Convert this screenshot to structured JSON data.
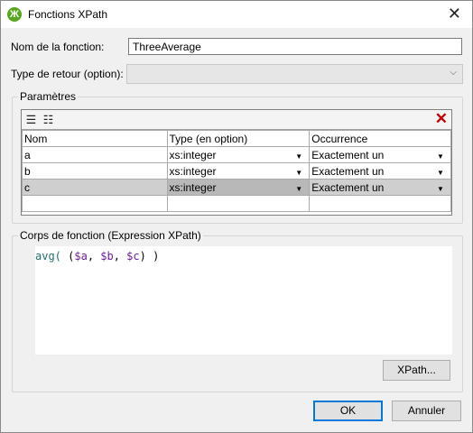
{
  "window": {
    "title": "Fonctions XPath",
    "close_glyph": "✕",
    "app_icon_glyph": "Ж"
  },
  "form": {
    "name_label": "Nom de la fonction:",
    "name_value": "ThreeAverage",
    "return_label": "Type de retour (option):",
    "return_value": ""
  },
  "params": {
    "group_title": "Paramètres",
    "toolbar": {
      "insert_icon": "☰",
      "append_icon": "☷",
      "delete_icon": "✕"
    },
    "columns": [
      "Nom",
      "Type (en option)",
      "Occurrence"
    ],
    "rows": [
      {
        "name": "a",
        "type": "xs:integer",
        "occurrence": "Exactement un"
      },
      {
        "name": "b",
        "type": "xs:integer",
        "occurrence": "Exactement un"
      },
      {
        "name": "c",
        "type": "xs:integer",
        "occurrence": "Exactement un"
      }
    ],
    "selected_row": 2
  },
  "body": {
    "group_title": "Corps de fonction (Expression XPath)",
    "code": {
      "fn": "avg(",
      "open": " (",
      "a": "$a",
      "sep1": ", ",
      "b": "$b",
      "sep2": ", ",
      "c": "$c",
      "close": ") ",
      "end": ")"
    },
    "xpath_button": "XPath..."
  },
  "buttons": {
    "ok": "OK",
    "cancel": "Annuler"
  },
  "colors": {
    "app_icon": "#5aa61f",
    "delete": "#c00000",
    "fn": "#1f6f6f",
    "var": "#6a1b9a",
    "default_border": "#0078d7"
  }
}
